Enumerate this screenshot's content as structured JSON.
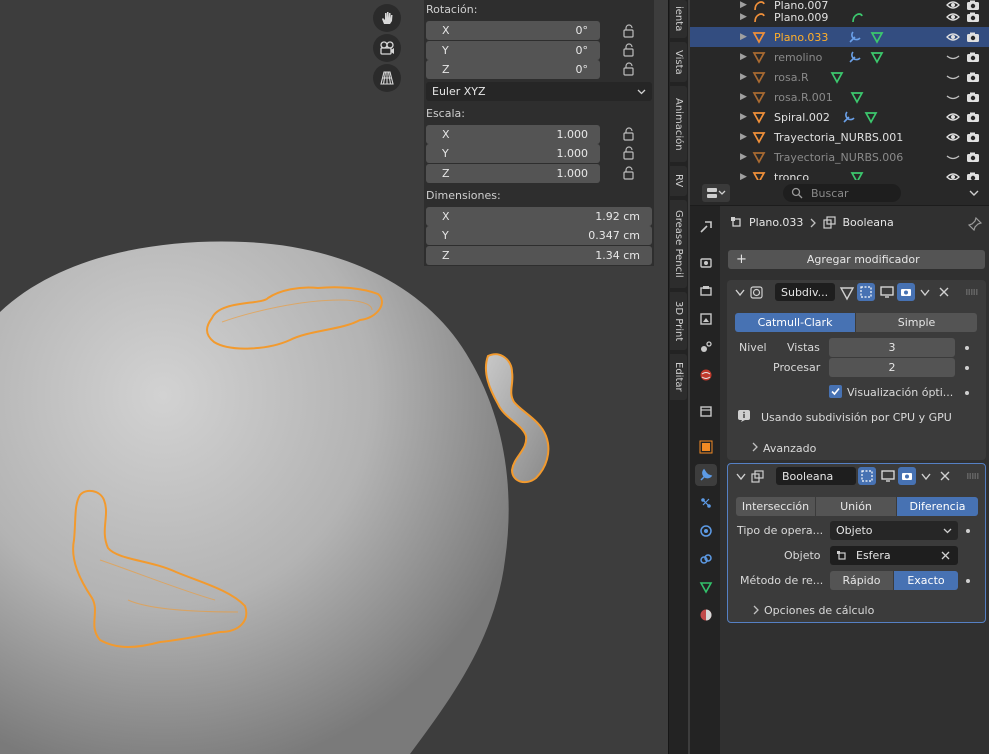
{
  "npanel": {
    "rotation_label": "Rotación:",
    "rotation": [
      {
        "axis": "X",
        "value": "0°"
      },
      {
        "axis": "Y",
        "value": "0°"
      },
      {
        "axis": "Z",
        "value": "0°"
      }
    ],
    "rotation_mode": "Euler XYZ",
    "scale_label": "Escala:",
    "scale": [
      {
        "axis": "X",
        "value": "1.000"
      },
      {
        "axis": "Y",
        "value": "1.000"
      },
      {
        "axis": "Z",
        "value": "1.000"
      }
    ],
    "dimensions_label": "Dimensiones:",
    "dimensions": [
      {
        "axis": "X",
        "value": "1.92 cm"
      },
      {
        "axis": "Y",
        "value": "0.347 cm"
      },
      {
        "axis": "Z",
        "value": "1.34 cm"
      }
    ]
  },
  "side_tabs": [
    "ienta",
    "Vista",
    "Animación",
    "RV",
    "Grease Pencil",
    "3D Print",
    "Editar"
  ],
  "outliner": {
    "rows": [
      {
        "name": "Plano.007",
        "icon": "curve-icon",
        "state": "normal"
      },
      {
        "name": "Plano.009",
        "icon": "curve-icon",
        "state": "normal"
      },
      {
        "name": "Plano.033",
        "icon": "mesh-icon",
        "state": "selected"
      },
      {
        "name": "remolino",
        "icon": "mesh-icon",
        "state": "dim"
      },
      {
        "name": "rosa.R",
        "icon": "mesh-icon",
        "state": "dim"
      },
      {
        "name": "rosa.R.001",
        "icon": "mesh-icon",
        "state": "dim"
      },
      {
        "name": "Spiral.002",
        "icon": "mesh-icon",
        "state": "normal"
      },
      {
        "name": "Trayectoria_NURBS.001",
        "icon": "mesh-icon",
        "state": "normal"
      },
      {
        "name": "Trayectoria_NURBS.006",
        "icon": "mesh-icon",
        "state": "dim"
      },
      {
        "name": "tronco",
        "icon": "mesh-icon",
        "state": "normal"
      }
    ]
  },
  "properties": {
    "search_placeholder": "Buscar",
    "breadcrumb_object": "Plano.033",
    "breadcrumb_modifier": "Booleana",
    "add_modifier": "Agregar modificador",
    "subdiv": {
      "name": "Subdiv...",
      "mode_options": [
        "Catmull-Clark",
        "Simple"
      ],
      "mode_selected": "Catmull-Clark",
      "nivel_label": "Nivel",
      "viewport_label": "Vistas",
      "viewport_value": "3",
      "render_label": "Procesar",
      "render_value": "2",
      "optimal_label": "Visualización ópti...",
      "info": "Usando subdivisión por CPU y GPU",
      "advanced": "Avanzado"
    },
    "boolean": {
      "name": "Booleana",
      "ops": [
        "Intersección",
        "Unión",
        "Diferencia"
      ],
      "op_selected": "Diferencia",
      "operand_label": "Tipo de opera...",
      "operand_value": "Objeto",
      "object_label": "Objeto",
      "object_value": "Esfera",
      "solver_label": "Método de re...",
      "solver_options": [
        "Rápido",
        "Exacto"
      ],
      "solver_selected": "Exacto",
      "calc_options": "Opciones de cálculo"
    }
  }
}
